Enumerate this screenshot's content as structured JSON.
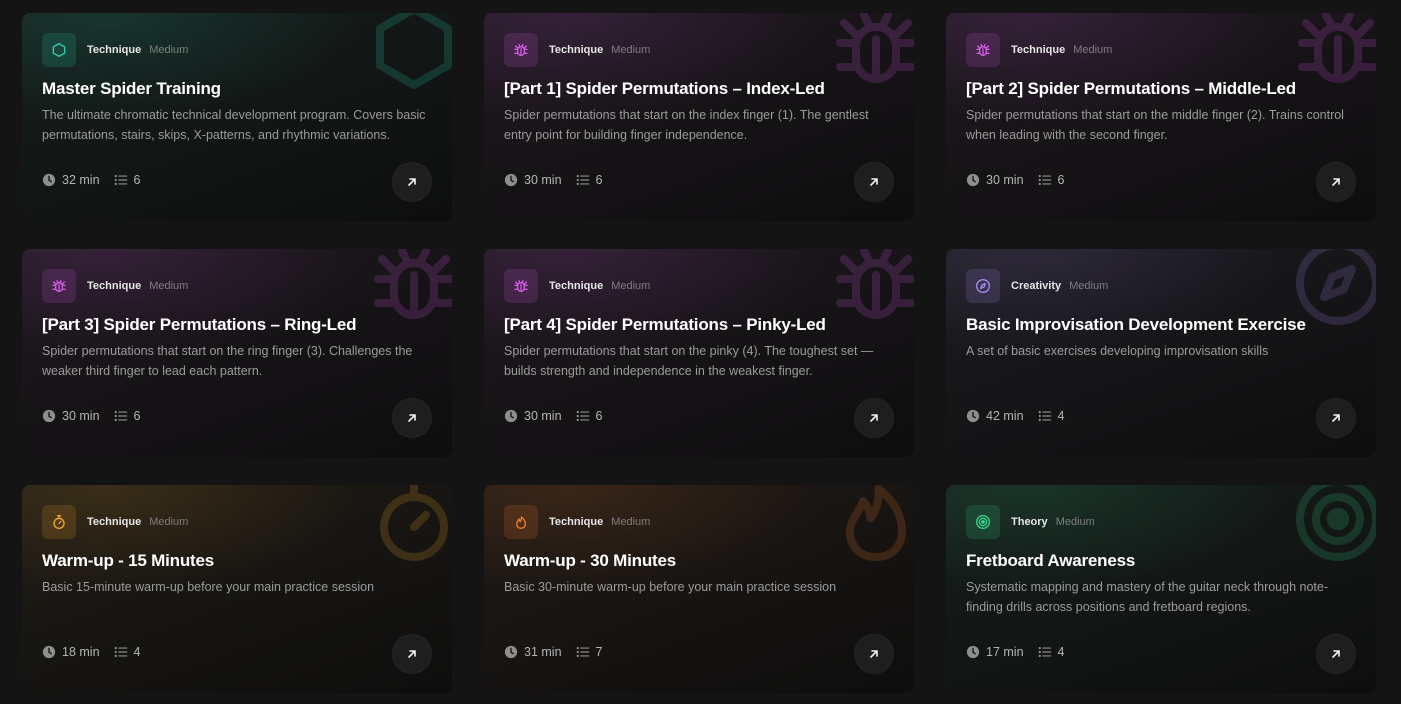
{
  "colors": {
    "teal": "#2bd4b0",
    "magenta": "#d55ce8",
    "violet": "#a98cf0",
    "amber": "#f0a82a",
    "orange": "#f07c2a",
    "green": "#35d28c"
  },
  "cards": [
    {
      "theme": "teal",
      "icon": "hexagon-icon",
      "category": "Technique",
      "level": "Medium",
      "title": "Master Spider Training",
      "description": "The ultimate chromatic technical development program. Covers basic permutations, stairs, skips, X-patterns, and rhythmic variations.",
      "duration": "32 min",
      "count": "6"
    },
    {
      "theme": "magenta",
      "icon": "bug-icon",
      "category": "Technique",
      "level": "Medium",
      "title": "[Part 1] Spider Permutations – Index-Led",
      "description": "Spider permutations that start on the index finger (1). The gentlest entry point for building finger independence.",
      "duration": "30 min",
      "count": "6"
    },
    {
      "theme": "magenta",
      "icon": "bug-icon",
      "category": "Technique",
      "level": "Medium",
      "title": "[Part 2] Spider Permutations – Middle-Led",
      "description": "Spider permutations that start on the middle finger (2). Trains control when leading with the second finger.",
      "duration": "30 min",
      "count": "6"
    },
    {
      "theme": "magenta",
      "icon": "bug-icon",
      "category": "Technique",
      "level": "Medium",
      "title": "[Part 3] Spider Permutations – Ring-Led",
      "description": "Spider permutations that start on the ring finger (3). Challenges the weaker third finger to lead each pattern.",
      "duration": "30 min",
      "count": "6"
    },
    {
      "theme": "magenta",
      "icon": "bug-icon",
      "category": "Technique",
      "level": "Medium",
      "title": "[Part 4] Spider Permutations – Pinky-Led",
      "description": "Spider permutations that start on the pinky (4). The toughest set — builds strength and independence in the weakest finger.",
      "duration": "30 min",
      "count": "6"
    },
    {
      "theme": "violet",
      "icon": "compass-icon",
      "category": "Creativity",
      "level": "Medium",
      "title": "Basic Improvisation Development Exercise",
      "description": "A set of basic exercises developing improvisation skills",
      "duration": "42 min",
      "count": "4"
    },
    {
      "theme": "amber",
      "icon": "stopwatch-icon",
      "category": "Technique",
      "level": "Medium",
      "title": "Warm-up - 15 Minutes",
      "description": "Basic 15-minute warm-up before your main practice session",
      "duration": "18 min",
      "count": "4"
    },
    {
      "theme": "orange",
      "icon": "flame-icon",
      "category": "Technique",
      "level": "Medium",
      "title": "Warm-up - 30 Minutes",
      "description": "Basic 30-minute warm-up before your main practice session",
      "duration": "31 min",
      "count": "7"
    },
    {
      "theme": "green",
      "icon": "target-icon",
      "category": "Theory",
      "level": "Medium",
      "title": "Fretboard Awareness",
      "description": "Systematic mapping and mastery of the guitar neck through note-finding drills across positions and fretboard regions.",
      "duration": "17 min",
      "count": "4"
    }
  ]
}
